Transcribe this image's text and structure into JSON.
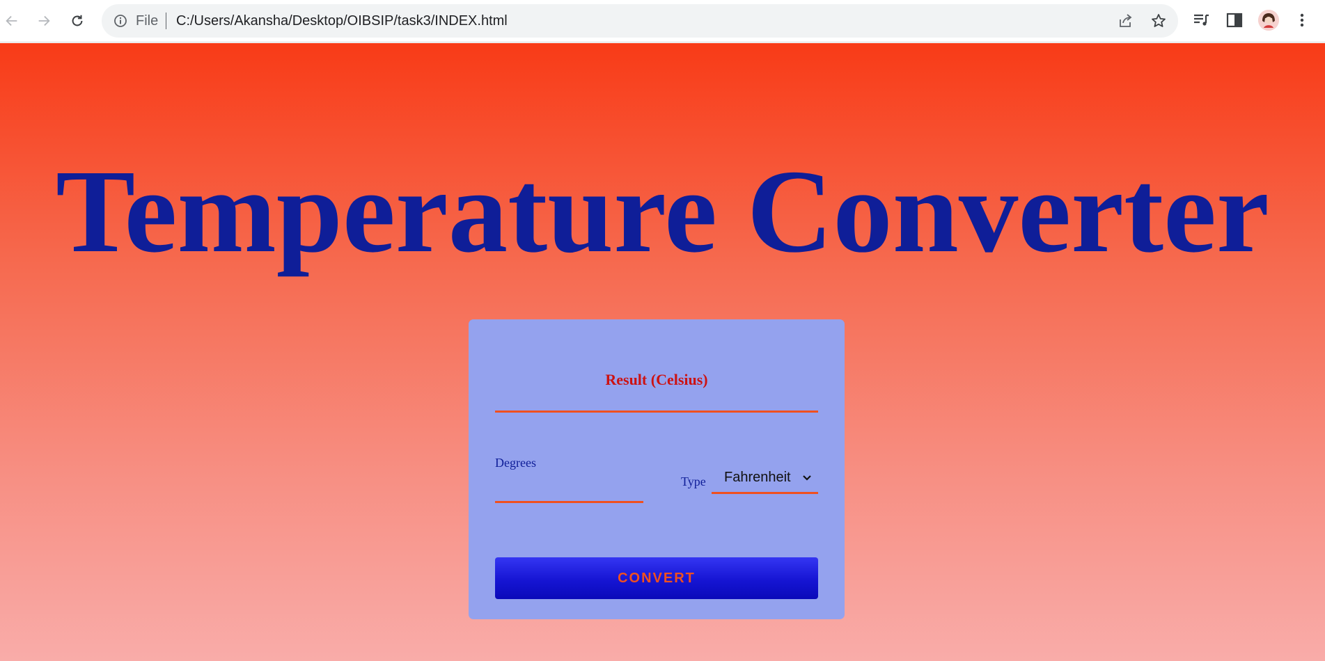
{
  "browser": {
    "scheme_label": "File",
    "url": "C:/Users/Akansha/Desktop/OIBSIP/task3/INDEX.html",
    "icons": [
      "back-arrow-icon",
      "forward-arrow-icon",
      "reload-icon",
      "info-icon",
      "share-icon",
      "star-icon",
      "reading-list-icon",
      "side-panel-icon",
      "avatar",
      "more-vert-icon"
    ]
  },
  "page": {
    "title": "Temperature Converter",
    "colors": {
      "title": "#0f1e98",
      "background_top": "#f83b17",
      "background_bottom": "#f9aca9",
      "card": "#94a2ee",
      "accent": "#f0501f",
      "result_label": "#cc1212",
      "button": "#1615d3"
    }
  },
  "converter": {
    "result_label": "Result (Celsius)",
    "degrees_label": "Degrees",
    "degrees_value": "",
    "type_label": "Type",
    "type_selected": "Fahrenheit",
    "convert_label": "CONVERT"
  }
}
